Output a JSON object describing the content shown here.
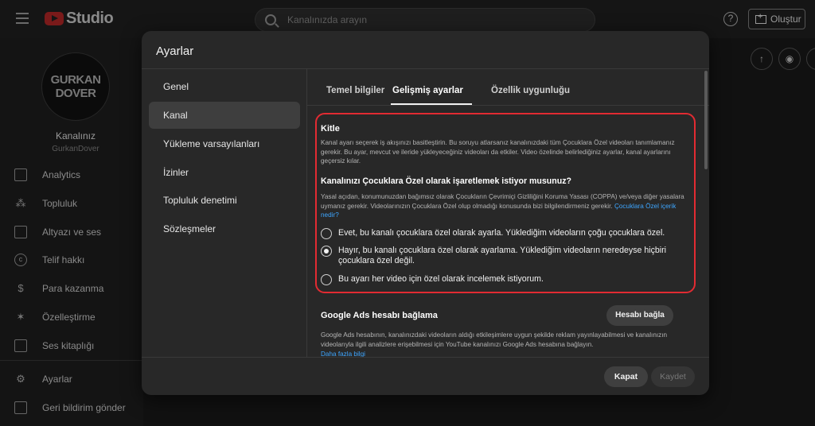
{
  "app": {
    "logo_text": "Studio"
  },
  "topbar": {
    "search_placeholder": "Kanalınızda arayın",
    "help_icon": "?",
    "create_label": "Oluştur"
  },
  "channel": {
    "avatar_line1": "GURKAN",
    "avatar_line2": "DOVER",
    "name": "Kanalınız",
    "handle": "GurkanDover"
  },
  "sidebar": {
    "items": [
      {
        "label": "Analytics",
        "icon": "analytics-icon"
      },
      {
        "label": "Topluluk",
        "icon": "community-icon"
      },
      {
        "label": "Altyazı ve ses",
        "icon": "subtitles-icon"
      },
      {
        "label": "Telif hakkı",
        "icon": "copyright-icon"
      },
      {
        "label": "Para kazanma",
        "icon": "dollar-icon"
      },
      {
        "label": "Özelleştirme",
        "icon": "wand-icon"
      },
      {
        "label": "Ses kitaplığı",
        "icon": "audio-library-icon"
      }
    ],
    "bottom": [
      {
        "label": "Ayarlar",
        "icon": "gear-icon"
      },
      {
        "label": "Geri bildirim gönder",
        "icon": "feedback-icon"
      }
    ]
  },
  "modal": {
    "title": "Ayarlar",
    "menu": [
      "Genel",
      "Kanal",
      "Yükleme varsayılanları",
      "İzinler",
      "Topluluk denetimi",
      "Sözleşmeler"
    ],
    "active_menu": "Kanal",
    "tabs": [
      "Temel bilgiler",
      "Gelişmiş ayarlar",
      "Özellik uygunluğu"
    ],
    "active_tab": "Gelişmiş ayarlar",
    "audience": {
      "title": "Kitle",
      "description": "Kanal ayarı seçerek iş akışınızı basitleştirin. Bu soruyu atlarsanız kanalınızdaki tüm Çocuklara Özel videoları tanımlamanız gerekir. Bu ayar, mevcut ve ileride yükleyeceğiniz videoları da etkiler. Video özelinde belirlediğiniz ayarlar, kanal ayarlarını geçersiz kılar.",
      "question": "Kanalınızı Çocuklara Özel olarak işaretlemek istiyor musunuz?",
      "legal_text": "Yasal açıdan, konumunuzdan bağımsız olarak Çocukların Çevrimiçi Gizliliğini Koruma Yasası (COPPA) ve/veya diğer yasalara uymanız gerekir. Videolarınızın Çocuklara Özel olup olmadığı konusunda bizi bilgilendirmeniz gerekir.",
      "legal_link": "Çocuklara Özel içerik nedir?",
      "options": [
        "Evet, bu kanalı çocuklara özel olarak ayarla. Yüklediğim videoların çoğu çocuklara özel.",
        "Hayır, bu kanalı çocuklara özel olarak ayarlama. Yüklediğim videoların neredeyse hiçbiri çocuklara özel değil.",
        "Bu ayarı her video için özel olarak incelemek istiyorum."
      ],
      "selected_index": 1
    },
    "google_ads": {
      "title": "Google Ads hesabı bağlama",
      "button": "Hesabı bağla",
      "text": "Google Ads hesabının, kanalınızdaki videoların aldığı etkileşimlere uygun şekilde reklam yayınlayabilmesi ve kanalınızın videolarıyla ilgili analizlere erişebilmesi için YouTube kanalınızı Google Ads hesabına bağlayın.",
      "more_link": "Daha fazla bilgi"
    },
    "footer": {
      "close": "Kapat",
      "save": "Kaydet"
    }
  }
}
